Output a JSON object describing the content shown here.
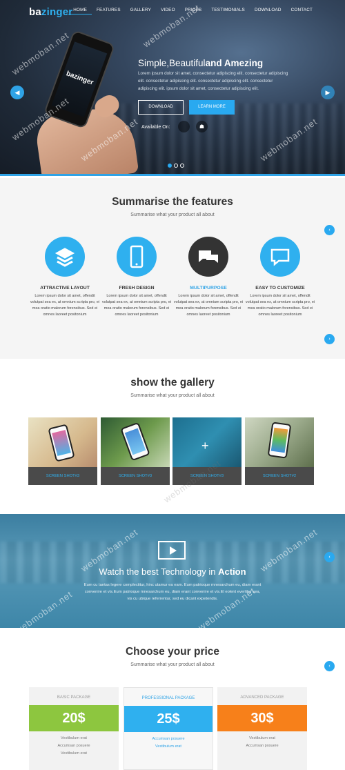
{
  "brand": {
    "prefix": "ba",
    "accent": "zinger"
  },
  "nav": [
    "HOME",
    "FEATURES",
    "GALLERY",
    "VIDEO",
    "PRICES",
    "TESTIMONIALS",
    "DOWNLOAD",
    "CONTACT"
  ],
  "hero": {
    "phone_logo": "bazinger",
    "title_plain": "Simple,Beautiful",
    "title_bold": "and Amezing",
    "text": "Lorem ipsum dolor sit amet, consectetur adipiscing elit. consectetur adipiscing elit. consectetur adipiscing elit. consectetur adipiscing elit. consectetur adipiscing elit. ipsum dolor sit amet, consectetur adipiscing elit.",
    "download_label": "DOWNLOAD",
    "learn_label": "LEARN MORE",
    "available_label": "Available On:",
    "active_slide": 1
  },
  "features": {
    "title": "Summarise the features",
    "subtitle": "Summarise what your product all about",
    "items": [
      {
        "title": "ATTRACTIVE LAYOUT",
        "icon": "layers-icon",
        "text": "Lorem ipsum dolor sit amet, offendit volutpat sea ex, at omnium scripta pro, ei mea oratio malorum forensibus. Sed ei omnes laoreet positonium"
      },
      {
        "title": "FRESH DESIGN",
        "icon": "phone-icon",
        "text": "Lorem ipsum dolor sit amet, offendit volutpat sea ex, at omnium scripta pro, ei mea oratio malorum forensibus. Sed ei omnes laoreet positonium"
      },
      {
        "title": "MULTIPURPOSE",
        "icon": "chat-icon",
        "text": "Lorem ipsum dolor sit amet, offendit volutpat sea ex, at omnium scripta pro, ei mea oratio malorum forensibus. Sed ei omnes laoreet positonium"
      },
      {
        "title": "EASY TO CUSTOMIZE",
        "icon": "message-icon",
        "text": "Lorem ipsum dolor sit amet, offendit volutpat sea ex, at omnium scripta pro, ei mea oratio malorum forensibus. Sed ei omnes laoreet positonium"
      }
    ]
  },
  "gallery": {
    "title": "show the gallery",
    "subtitle": "Summarise what your product all about",
    "items": [
      "SCREEN SHOT#3",
      "SCREEN SHOT#3",
      "SCREEN SHOT#3",
      "SCREEN SHOT#2"
    ]
  },
  "video": {
    "title_plain": "Watch the best Technology in ",
    "title_bold": "Action",
    "text": "Eum cu tantas legere complectitur, hinc utamur ea eam. Eum patrioque mnesarchum eu, diam erant convenire et vis.Eum patrioque mnesarchum eu, diam erant convenire et vis.El eolent evertitur sea, vis cu ubique referrentur, sed eu dicant expetendis."
  },
  "pricing": {
    "title": "Choose your price",
    "subtitle": "Summarise what your product all about",
    "plans": [
      {
        "name": "BASIC PACKAGE",
        "price": "20$",
        "color": "#8dc63f",
        "features": [
          "Vestibulum erat",
          "Accumsan posuere",
          "Vestibulum erat"
        ]
      },
      {
        "name": "PROFESSIONAL PACKAGE",
        "price": "25$",
        "color": "#2fb0ef",
        "features": [
          "Accumsan posuere",
          "Vestibulum erat"
        ]
      },
      {
        "name": "ADVANCED PACKAGE",
        "price": "30$",
        "color": "#f7801a",
        "features": [
          "Vestibulum erat",
          "Accumsan posuere"
        ]
      }
    ]
  },
  "watermark": "webmoban.net",
  "colors": {
    "accent": "#2fa3e6",
    "green": "#8dc63f",
    "orange": "#f7801a",
    "dark": "#333333"
  }
}
